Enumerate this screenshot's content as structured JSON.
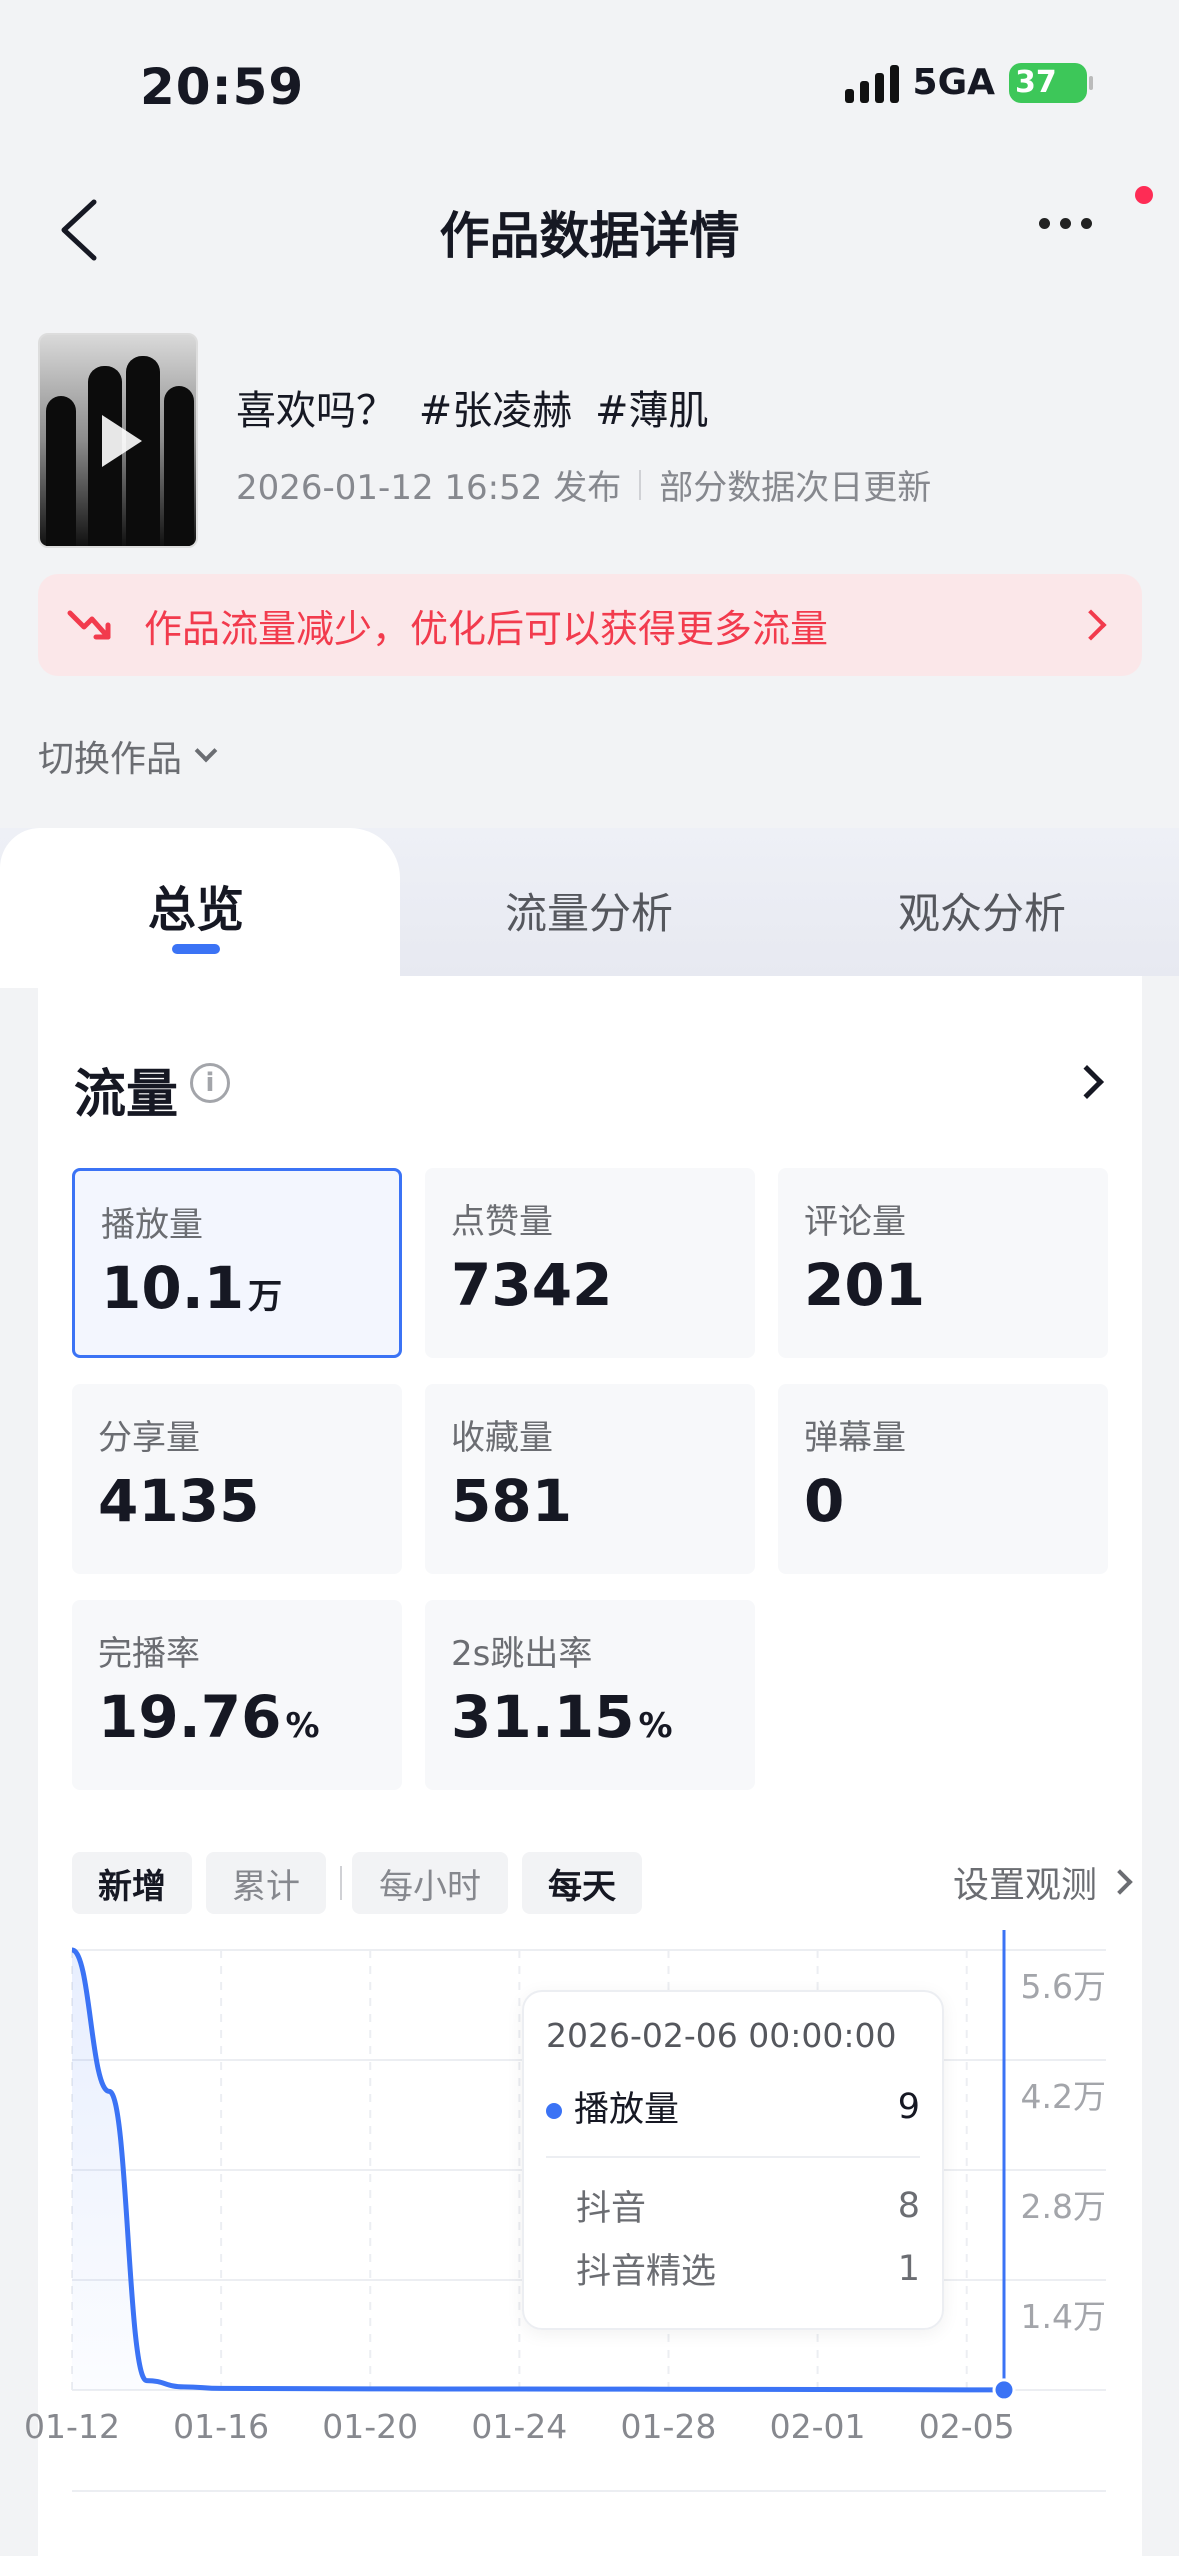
{
  "status_bar": {
    "time": "20:59",
    "network": "5GA",
    "battery": "37"
  },
  "nav": {
    "title": "作品数据详情"
  },
  "work": {
    "title": "喜欢吗？ #张凌赫 #薄肌",
    "publish_time": "2026-01-12 16:52 发布",
    "update_note": "部分数据次日更新"
  },
  "alert": {
    "text": "作品流量减少，优化后可以获得更多流量"
  },
  "switch_label": "切换作品",
  "tabs": [
    {
      "label": "总览"
    },
    {
      "label": "流量分析"
    },
    {
      "label": "观众分析"
    }
  ],
  "section": {
    "title": "流量"
  },
  "metrics": [
    {
      "label": "播放量",
      "value": "10.1",
      "unit": "万"
    },
    {
      "label": "点赞量",
      "value": "7342",
      "unit": ""
    },
    {
      "label": "评论量",
      "value": "201",
      "unit": ""
    },
    {
      "label": "分享量",
      "value": "4135",
      "unit": ""
    },
    {
      "label": "收藏量",
      "value": "581",
      "unit": ""
    },
    {
      "label": "弹幕量",
      "value": "0",
      "unit": ""
    },
    {
      "label": "完播率",
      "value": "19.76",
      "unit": "%"
    },
    {
      "label": "2s跳出率",
      "value": "31.15",
      "unit": "%"
    }
  ],
  "chart_controls": {
    "mode": [
      "新增",
      "累计"
    ],
    "granularity": [
      "每小时",
      "每天"
    ],
    "observe_label": "设置观测"
  },
  "chart_data": {
    "type": "area",
    "x": [
      "01-12",
      "01-13",
      "01-14",
      "01-15",
      "01-16",
      "01-20",
      "01-24",
      "01-28",
      "02-01",
      "02-05",
      "02-06"
    ],
    "x_tick_labels": [
      "01-12",
      "01-16",
      "01-20",
      "01-24",
      "01-28",
      "02-01",
      "02-05"
    ],
    "y_tick_labels": [
      "5.6万",
      "4.2万",
      "2.8万",
      "1.4万"
    ],
    "ylim": [
      0,
      56000
    ],
    "series": [
      {
        "name": "播放量",
        "values": [
          56000,
          38000,
          1200,
          400,
          200,
          150,
          120,
          100,
          60,
          20,
          9
        ]
      }
    ],
    "color": "#3b73f5"
  },
  "tooltip": {
    "time": "2026-02-06 00:00:00",
    "main": {
      "label": "播放量",
      "value": "9"
    },
    "sub": [
      {
        "label": "抖音",
        "value": "8"
      },
      {
        "label": "抖音精选",
        "value": "1"
      }
    ]
  }
}
